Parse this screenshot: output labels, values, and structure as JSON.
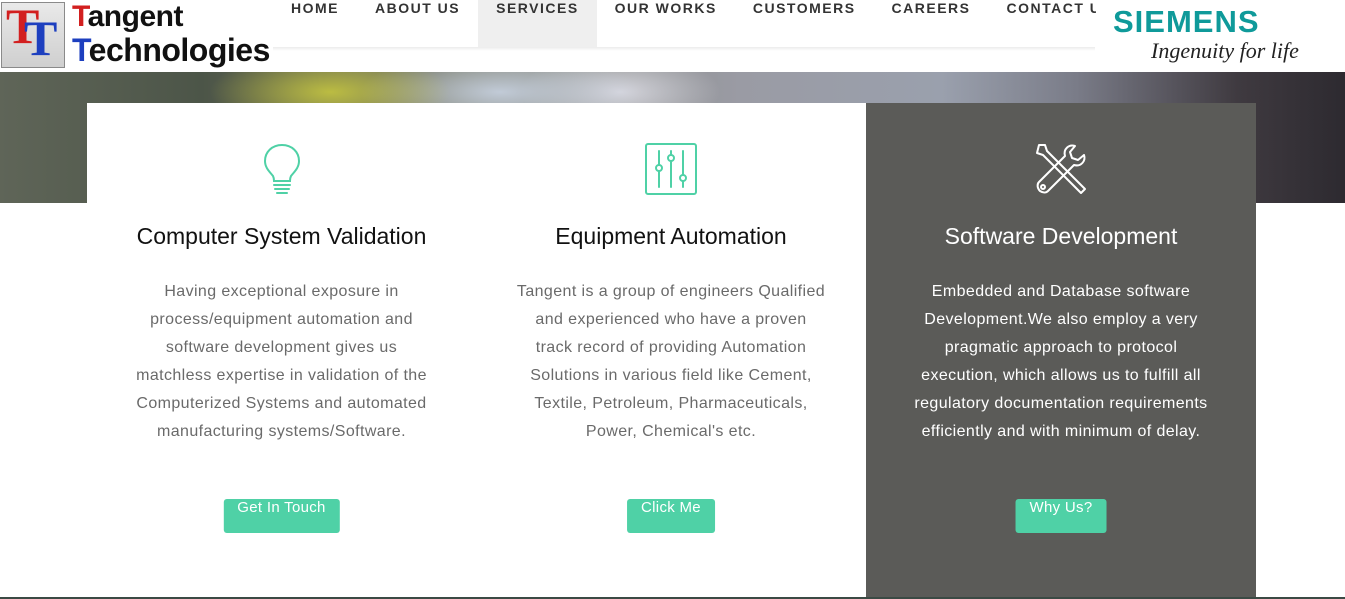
{
  "logo": {
    "mark_letter_1": "T",
    "mark_letter_2": "T",
    "line1_cap": "T",
    "line1_rest": "angent",
    "line2_cap": "T",
    "line2_rest": "echnologies"
  },
  "nav": {
    "items": [
      {
        "label": "HOME",
        "active": false
      },
      {
        "label": "ABOUT US",
        "active": false
      },
      {
        "label": "SERVICES",
        "active": true
      },
      {
        "label": "OUR WORKS",
        "active": false
      },
      {
        "label": "CUSTOMERS",
        "active": false
      },
      {
        "label": "CAREERS",
        "active": false
      },
      {
        "label": "CONTACT US",
        "active": false
      }
    ]
  },
  "partner": {
    "brand": "SIEMENS",
    "tagline": "Ingenuity for life"
  },
  "colors": {
    "accent": "#4fd1a6",
    "dark_card": "#5b5b58",
    "brand_teal": "#0f9a9a"
  },
  "services": [
    {
      "icon": "lightbulb-icon",
      "title": "Computer System Validation",
      "description": "Having exceptional exposure in process/equipment automation and software development gives us matchless expertise in validation of the Computerized Systems and automated manufacturing systems/Software.",
      "button": "Get In Touch"
    },
    {
      "icon": "sliders-icon",
      "title": "Equipment Automation",
      "description": "Tangent is a group of engineers Qualified and experienced who have a proven track record of providing Automation Solutions in various field like Cement, Textile, Petroleum, Pharmaceuticals, Power, Chemical's etc.",
      "button": "Click Me"
    },
    {
      "icon": "tools-icon",
      "title": "Software Development",
      "description": "Embedded and Database software Development.We also employ a very pragmatic approach to protocol execution, which allows us to fulfill all regulatory documentation requirements efficiently and with minimum of delay.",
      "button": "Why Us?"
    }
  ]
}
